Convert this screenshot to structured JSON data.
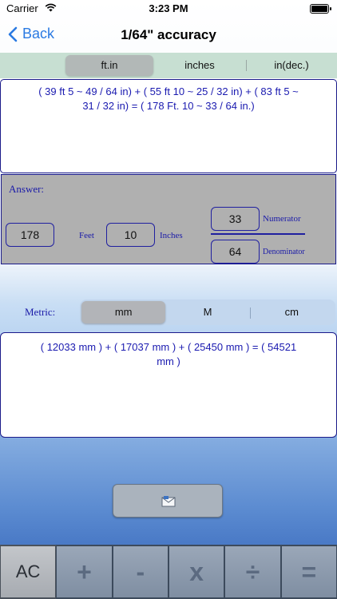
{
  "status": {
    "carrier": "Carrier",
    "time": "3:23 PM"
  },
  "nav": {
    "back_label": "Back",
    "title": "1/64\" accuracy"
  },
  "unit_tabs": [
    {
      "label": "ft.in",
      "selected": true
    },
    {
      "label": "inches",
      "selected": false
    },
    {
      "label": "in(dec.)",
      "selected": false
    }
  ],
  "expression": {
    "line1": "( 39 ft 5 ~ 49 / 64 in)  +  ( 55 ft 10 ~ 25 / 32 in)  +  ( 83 ft 5 ~",
    "line2": "31 / 32 in)  = ( 178 Ft. 10 ~ 33 / 64 in.)"
  },
  "answer": {
    "label": "Answer:",
    "feet_value": "178",
    "feet_unit": "Feet",
    "inches_value": "10",
    "inches_unit": "Inches",
    "numerator_value": "33",
    "numerator_label": "Numerator",
    "denominator_value": "64",
    "denominator_label": "Denominator"
  },
  "metric": {
    "label": "Metric:",
    "tabs": [
      {
        "label": "mm",
        "selected": true
      },
      {
        "label": "M",
        "selected": false
      },
      {
        "label": "cm",
        "selected": false
      }
    ],
    "line1": "( 12033 mm )  +  ( 17037 mm )  +  ( 25450 mm )  =  ( 54521",
    "line2": "mm )"
  },
  "mail_button": {
    "icon": "mail-icon"
  },
  "keypad": [
    "AC",
    "+",
    "-",
    "x",
    "÷",
    "="
  ],
  "colors": {
    "accent": "#2a7ae2",
    "text_blue": "#1a1ab0",
    "panel_gray": "#b0b0b0",
    "strip_green": "#c7dfd2"
  }
}
